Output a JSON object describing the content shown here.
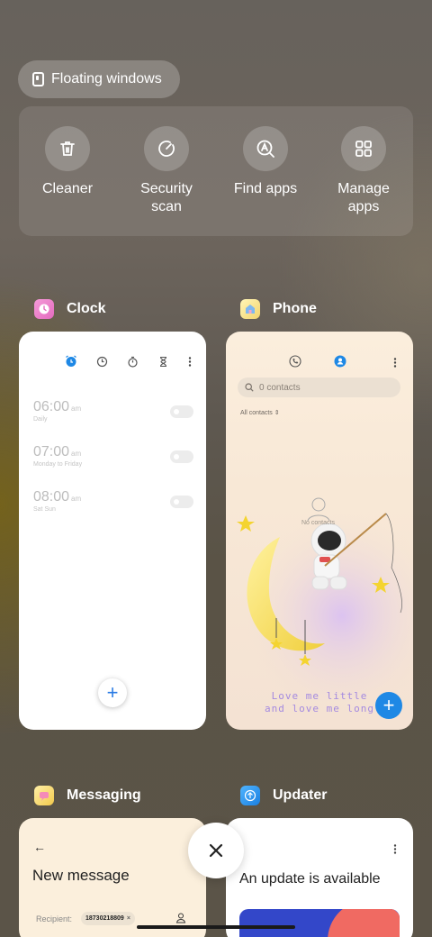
{
  "floating_windows": {
    "label": "Floating windows"
  },
  "quick_actions": [
    {
      "label": "Cleaner",
      "icon": "trash-icon"
    },
    {
      "label": "Security\nscan",
      "icon": "scan-icon"
    },
    {
      "label": "Find apps",
      "icon": "find-apps-icon"
    },
    {
      "label": "Manage\napps",
      "icon": "grid-icon"
    }
  ],
  "apps": {
    "clock": {
      "name": "Clock",
      "alarms": [
        {
          "time": "06:00",
          "ampm": "am",
          "repeat": "Daily"
        },
        {
          "time": "07:00",
          "ampm": "am",
          "repeat": "Monday to Friday"
        },
        {
          "time": "08:00",
          "ampm": "am",
          "repeat": "Sat Sun"
        }
      ],
      "fab_symbol": "+"
    },
    "phone": {
      "name": "Phone",
      "search_placeholder": "0 contacts",
      "filter": "All contacts",
      "empty_label": "No contacts",
      "slogan_line1": "Love me little",
      "slogan_line2": "and love me long",
      "fab_symbol": "+"
    },
    "messaging": {
      "name": "Messaging",
      "back": "←",
      "title": "New message",
      "recipient_label": "Recipient:",
      "recipient_chip": "18730218809",
      "chip_close": "×"
    },
    "updater": {
      "name": "Updater",
      "title": "An update is available"
    }
  },
  "close_all": {
    "symbol": "×"
  },
  "colors": {
    "accent_blue": "#1e88e5",
    "phone_bg": "#fbeedd",
    "messaging_bg": "#fbefdc"
  }
}
